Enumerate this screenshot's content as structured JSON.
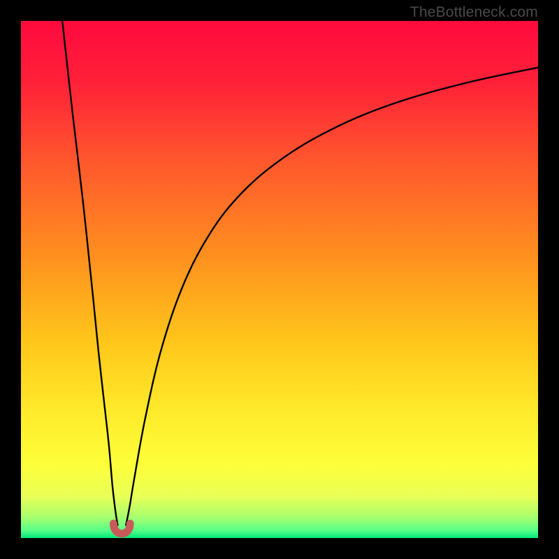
{
  "watermark": "TheBottleneck.com",
  "colors": {
    "frame": "#000000",
    "gradient_stops": [
      {
        "offset": 0.0,
        "color": "#ff0a3e"
      },
      {
        "offset": 0.12,
        "color": "#ff2138"
      },
      {
        "offset": 0.28,
        "color": "#ff5a2c"
      },
      {
        "offset": 0.45,
        "color": "#ff8e1f"
      },
      {
        "offset": 0.62,
        "color": "#ffc61a"
      },
      {
        "offset": 0.75,
        "color": "#ffe92a"
      },
      {
        "offset": 0.86,
        "color": "#fdff3a"
      },
      {
        "offset": 0.92,
        "color": "#e8ff57"
      },
      {
        "offset": 0.96,
        "color": "#a7ff6e"
      },
      {
        "offset": 0.985,
        "color": "#58ff88"
      },
      {
        "offset": 1.0,
        "color": "#00e87a"
      }
    ],
    "curve": "#000000",
    "marker": "#c85a5a"
  },
  "chart_data": {
    "type": "line",
    "title": "",
    "xlabel": "",
    "ylabel": "",
    "x_range": [
      0,
      100
    ],
    "y_range": [
      0,
      100
    ],
    "left_branch": {
      "description": "steep descending branch on left side",
      "x": [
        8,
        10,
        12,
        14,
        15,
        16,
        17,
        17.7,
        18.3,
        18.7
      ],
      "y": [
        100,
        82,
        65,
        46,
        36,
        27,
        18,
        10,
        5,
        2.5
      ]
    },
    "right_branch": {
      "description": "rising-then-flattening branch on right side",
      "x": [
        20.3,
        21,
        22,
        24,
        27,
        31,
        36,
        42,
        50,
        60,
        72,
        86,
        100
      ],
      "y": [
        2.5,
        6,
        12,
        23,
        36,
        48,
        58,
        66,
        73,
        79,
        84,
        88,
        91
      ]
    },
    "trough_marker": {
      "description": "small U-shaped marker at minimum",
      "x_center": 19.5,
      "y_center": 1.5,
      "width": 3.2,
      "height": 2.6
    }
  }
}
